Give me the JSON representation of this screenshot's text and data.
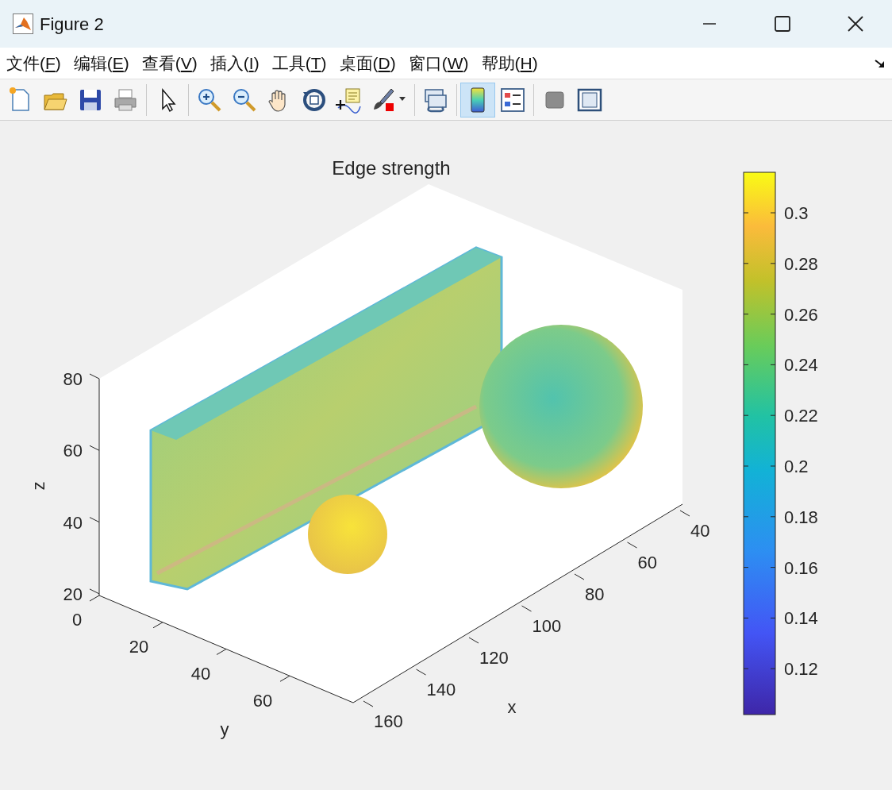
{
  "window": {
    "title": "Figure 2"
  },
  "menu": [
    {
      "label": "文件(F)"
    },
    {
      "label": "编辑(E)"
    },
    {
      "label": "查看(V)"
    },
    {
      "label": "插入(I)"
    },
    {
      "label": "工具(T)"
    },
    {
      "label": "桌面(D)"
    },
    {
      "label": "窗口(W)"
    },
    {
      "label": "帮助(H)"
    }
  ],
  "toolbar": [
    {
      "kind": "new",
      "selected": false
    },
    {
      "kind": "open",
      "selected": false
    },
    {
      "kind": "save",
      "selected": false
    },
    {
      "kind": "print",
      "selected": false
    },
    {
      "kind": "separator"
    },
    {
      "kind": "pointer",
      "selected": false
    },
    {
      "kind": "separator"
    },
    {
      "kind": "zoomin",
      "selected": false
    },
    {
      "kind": "zoomout",
      "selected": false
    },
    {
      "kind": "pan",
      "selected": false
    },
    {
      "kind": "rotate",
      "selected": false
    },
    {
      "kind": "datatip",
      "selected": false
    },
    {
      "kind": "brush",
      "selected": false
    },
    {
      "kind": "separator"
    },
    {
      "kind": "link",
      "selected": false
    },
    {
      "kind": "separator"
    },
    {
      "kind": "colorbar",
      "selected": true
    },
    {
      "kind": "legend",
      "selected": false
    },
    {
      "kind": "separator"
    },
    {
      "kind": "hide",
      "selected": false
    },
    {
      "kind": "frame",
      "selected": false
    }
  ],
  "axes": {
    "title": "Edge strength",
    "xlabel": "x",
    "ylabel": "y",
    "zlabel": "z",
    "xticks": [
      "160",
      "140",
      "120",
      "100",
      "80",
      "60",
      "40"
    ],
    "yticks": [
      "0",
      "20",
      "40",
      "60"
    ],
    "zticks": [
      "80",
      "60",
      "40",
      "20"
    ]
  },
  "colorbar": {
    "ticks": [
      "0.3",
      "0.28",
      "0.26",
      "0.24",
      "0.22",
      "0.2",
      "0.18",
      "0.16",
      "0.14",
      "0.12"
    ]
  }
}
